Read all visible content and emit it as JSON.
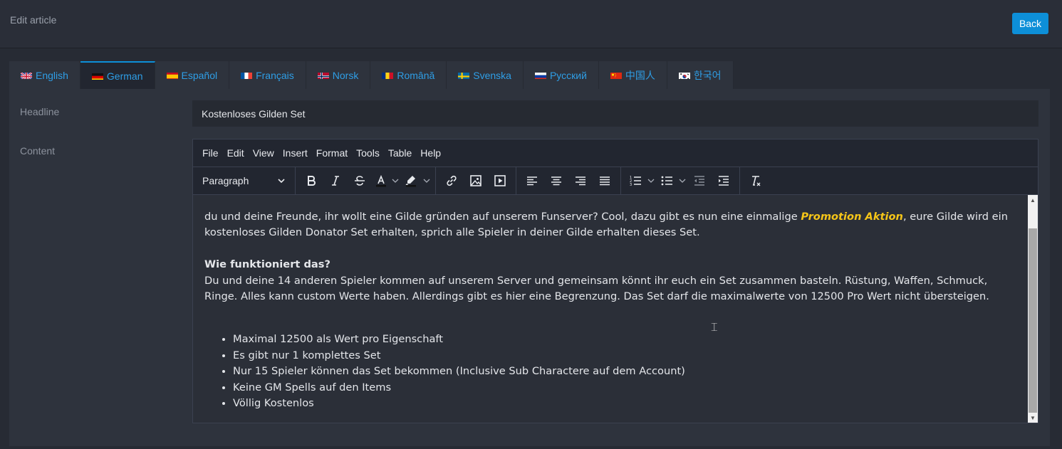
{
  "header": {
    "title": "Edit article",
    "back_label": "Back"
  },
  "tabs": [
    {
      "label": "English",
      "flag": "uk-flag-icon"
    },
    {
      "label": "German",
      "flag": "de-flag-icon",
      "active": true
    },
    {
      "label": "Español",
      "flag": "es-flag-icon"
    },
    {
      "label": "Français",
      "flag": "fr-flag-icon"
    },
    {
      "label": "Norsk",
      "flag": "no-flag-icon"
    },
    {
      "label": "Română",
      "flag": "ro-flag-icon"
    },
    {
      "label": "Svenska",
      "flag": "se-flag-icon"
    },
    {
      "label": "Русский",
      "flag": "ru-flag-icon"
    },
    {
      "label": "中国人",
      "flag": "cn-flag-icon"
    },
    {
      "label": "한국어",
      "flag": "kr-flag-icon"
    }
  ],
  "form": {
    "headline_label": "Headline",
    "headline_value": "Kostenloses Gilden Set",
    "content_label": "Content"
  },
  "editor": {
    "menu": [
      "File",
      "Edit",
      "View",
      "Insert",
      "Format",
      "Tools",
      "Table",
      "Help"
    ],
    "block_format": "Paragraph",
    "toolbar_icons": [
      "bold-icon",
      "italic-icon",
      "strikethrough-icon",
      "text-color-icon",
      "highlight-icon",
      "link-icon",
      "image-icon",
      "media-icon",
      "align-left-icon",
      "align-center-icon",
      "align-right-icon",
      "align-justify-icon",
      "numbered-list-icon",
      "bullet-list-icon",
      "outdent-icon",
      "indent-icon",
      "clear-formatting-icon"
    ],
    "body": {
      "intro_before": "du und deine Freunde, ihr wollt eine Gilde gründen auf unserem Funserver? Cool, dazu gibt es nun eine einmalige ",
      "promo": "Promotion Aktion",
      "intro_after": ", eure Gilde wird ein kostenloses Gilden Donator Set erhalten, sprich alle Spieler in deiner Gilde erhalten dieses Set.",
      "heading": "Wie funktioniert das?",
      "paragraph": "Du und deine 14 anderen Spieler kommen auf unserem Server und gemeinsam könnt ihr euch ein Set zusammen basteln. Rüstung, Waffen, Schmuck, Ringe. Alles kann custom Werte haben. Allerdings gibt es hier eine Begrenzung. Das Set darf die maximalwerte von 12500 Pro Wert nicht übersteigen.",
      "bullets": [
        "Maximal 12500 als Wert pro Eigenschaft",
        "Es gibt nur 1 komplettes Set",
        "Nur 15 Spieler können das Set bekommen (Inclusive Sub Charactere auf dem Account)",
        "Keine GM Spells auf den Items",
        "Völlig Kostenlos"
      ]
    }
  },
  "colors": {
    "accent": "#0d8fd8",
    "link": "#2e9ee6",
    "promo": "#f5c518"
  }
}
